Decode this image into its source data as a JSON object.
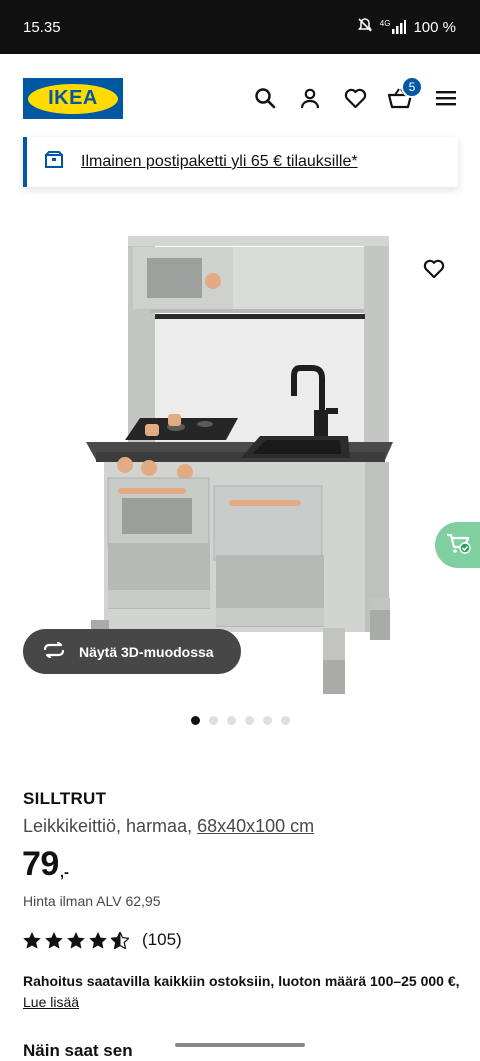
{
  "status": {
    "time": "15.35",
    "network": "4G",
    "battery": "100 %"
  },
  "header": {
    "logo_text": "IKEA",
    "cart_count": "5",
    "icons": [
      "search-icon",
      "user-icon",
      "heart-icon",
      "cart-icon",
      "menu-icon"
    ]
  },
  "banner": {
    "text": "Ilmainen postipaketti yli 65 € tilauksille*",
    "icon": "parcel-icon"
  },
  "gallery": {
    "view_3d_label": "Näytä 3D-muodossa",
    "dots_total": 6,
    "active_dot": 1
  },
  "product": {
    "name": "SILLTRUT",
    "description": "Leikkikeittiö, harmaa,",
    "dimensions": "68x40x100 cm",
    "price_integer": "79",
    "price_decimals": ",-",
    "vat_text": "Hinta ilman ALV 62,95",
    "rating_stars": 4.5,
    "rating_count": "(105)"
  },
  "finance": {
    "text": "Rahoitus saatavilla kaikkiin ostoksiin, luoton määrä 100–25 000 €,",
    "link": "Lue lisää"
  },
  "section": {
    "seen_title": "Näin saat sen"
  },
  "colors": {
    "ikea_blue": "#0058a3",
    "ikea_yellow": "#ffdb00",
    "sidecart_green": "#7fcfa0"
  }
}
